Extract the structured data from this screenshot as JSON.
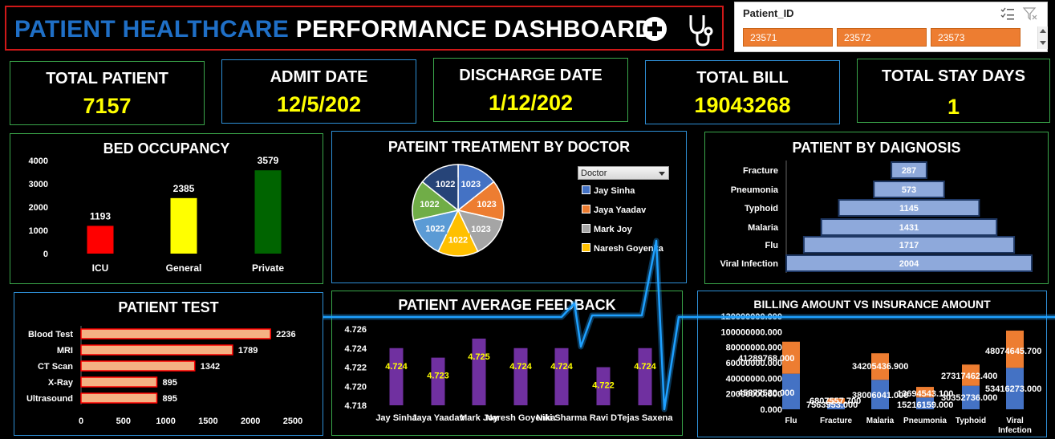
{
  "header": {
    "title_part1": "PATIENT HEALTHCARE",
    "title_part2": "PERFORMANCE DASHBOARD"
  },
  "slicer": {
    "title": "Patient_ID",
    "items": [
      "23571",
      "23572",
      "23573"
    ]
  },
  "kpis": [
    {
      "label": "TOTAL PATIENT",
      "value": "7157"
    },
    {
      "label": "ADMIT DATE",
      "value": "12/5/202"
    },
    {
      "label": "DISCHARGE DATE",
      "value": "1/12/202"
    },
    {
      "label": "TOTAL BILL",
      "value": "19043268"
    },
    {
      "label": "TOTAL STAY DAYS",
      "value": "1"
    }
  ],
  "panels": {
    "bed": "BED OCCUPANCY",
    "doctor": "PATEINT TREATMENT BY DOCTOR",
    "diagnosis": "PATIENT BY DAIGNOSIS",
    "test": "PATIENT TEST",
    "feedback": "PATIENT AVERAGE FEEDBACK",
    "billing": "BILLING AMOUNT VS INSURANCE AMOUNT"
  },
  "doctor_filter": {
    "label": "Doctor"
  },
  "colors": {
    "kpi_value": "#ffff00",
    "title_blue": "#1f6fc6",
    "title_border": "#d01818",
    "bed_icu": "#ff0000",
    "bed_general": "#ffff00",
    "bed_private": "#006400",
    "pie_1": "#4472c4",
    "pie_2": "#ed7d31",
    "pie_3": "#a5a5a5",
    "pie_4": "#ffc000",
    "pie_5": "#5b9bd5",
    "pie_6": "#70ad47",
    "pie_7": "#264478",
    "diag_fill": "#8ea9db",
    "diag_border": "#1f3864",
    "test_fill": "#f4b183",
    "test_border": "#ff0000",
    "feedback_bar": "#7030a0",
    "feedback_label": "#ffff00",
    "billing_insurance": "#4472c4",
    "billing_bill": "#ed7d31",
    "ecg_line": "#1ea0ff"
  },
  "chart_data": [
    {
      "type": "bar",
      "title": "BED OCCUPANCY",
      "categories": [
        "ICU",
        "General",
        "Private"
      ],
      "values": [
        1193,
        2385,
        3579
      ],
      "ylim": [
        0,
        4000
      ],
      "yticks": [
        "0",
        "1000",
        "2000",
        "3000",
        "4000"
      ]
    },
    {
      "type": "pie",
      "title": "PATEINT TREATMENT BY DOCTOR",
      "values": [
        1023,
        1023,
        1023,
        1022,
        1022,
        1022,
        1022
      ],
      "legend": [
        "Jay Sinha",
        "Jaya Yaadav",
        "Mark Joy",
        "Naresh Goyenka"
      ]
    },
    {
      "type": "bar",
      "title": "PATIENT BY DAIGNOSIS",
      "categories": [
        "Fracture",
        "Pneumonia",
        "Typhoid",
        "Malaria",
        "Flu",
        "Viral Infection"
      ],
      "values": [
        287,
        573,
        1145,
        1431,
        1717,
        2004
      ]
    },
    {
      "type": "bar",
      "title": "PATIENT TEST",
      "categories": [
        "Blood Test",
        "MRI",
        "CT Scan",
        "X-Ray",
        "Ultrasound"
      ],
      "values": [
        2236,
        1789,
        1342,
        895,
        895
      ],
      "xlim": [
        0,
        2500
      ],
      "xticks": [
        "0",
        "500",
        "1000",
        "1500",
        "2000",
        "2500"
      ]
    },
    {
      "type": "bar",
      "title": "PATIENT AVERAGE FEEDBACK",
      "categories": [
        "Jay Sinha",
        "Jaya Yaadav",
        "Mark Joy",
        "Naresh Goyenka",
        "Niki Sharma",
        "Ravi D",
        "Tejas Saxena"
      ],
      "values": [
        4.724,
        4.723,
        4.725,
        4.724,
        4.724,
        4.722,
        4.724
      ],
      "labels": [
        "4.724",
        "4.723",
        "4.725",
        "4.724",
        "4.724",
        "4.722",
        "4.724"
      ],
      "ylim": [
        4.718,
        4.726
      ],
      "yticks": [
        "4.718",
        "4.720",
        "4.722",
        "4.724",
        "4.726"
      ]
    },
    {
      "type": "bar",
      "title": "BILLING AMOUNT VS INSURANCE AMOUNT",
      "categories": [
        "Flu",
        "Fracture",
        "Malaria",
        "Pneumonia",
        "Typhoid",
        "Viral Infection"
      ],
      "series": [
        {
          "values": [
            45877520,
            7563953,
            38006041,
            15216159,
            30352736,
            53416273
          ],
          "labels": [
            "45877520.000",
            "7563953.000",
            "38006041.000",
            "15216159.000",
            "30352736.000",
            "53416273.000"
          ]
        },
        {
          "values": [
            41289768,
            6807557.7,
            34205436.9,
            13694543.1,
            27317462.4,
            48074645.7
          ],
          "labels": [
            "41289768.000",
            "6807557.700",
            "34205436.900",
            "13694543.100",
            "27317462.400",
            "48074645.700"
          ]
        }
      ],
      "ylim": [
        0,
        120000000
      ],
      "yticks": [
        "0.000",
        "20000000.000",
        "40000000.000",
        "60000000.000",
        "80000000.000",
        "100000000.000",
        "120000000.000"
      ]
    }
  ]
}
